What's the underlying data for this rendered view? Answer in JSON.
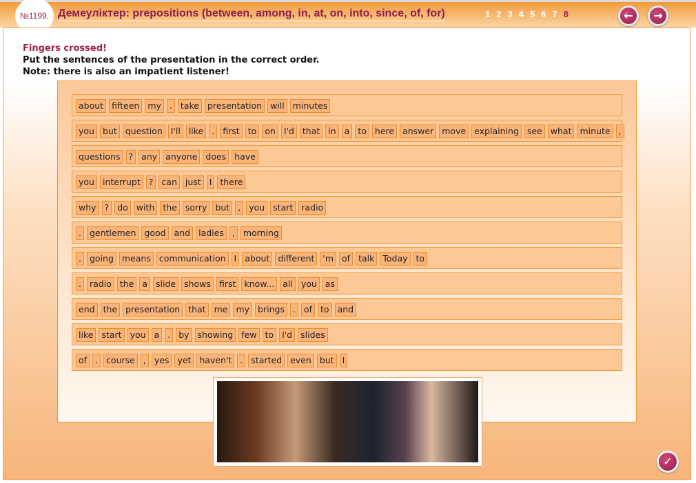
{
  "header": {
    "number": "№1199.",
    "title": "Демеуліктер: prepositions (between, among, in, at, on, into, since, of, for)",
    "pages": [
      "1",
      "2",
      "3",
      "4",
      "5",
      "6",
      "7",
      "8"
    ],
    "current_page": "8",
    "prev_icon": "arrow-left-icon",
    "next_icon": "arrow-right-icon"
  },
  "intro": {
    "heading": "Fingers crossed!",
    "line1": "Put the sentences of the presentation in the correct order.",
    "line2": "Note: there is also an impatient listener!"
  },
  "rows": [
    [
      "about",
      "fifteen",
      "my",
      ".",
      "take",
      "presentation",
      "will",
      "minutes"
    ],
    [
      "you",
      "but",
      "question",
      "I'll",
      "like",
      ".",
      "first",
      "to",
      "on",
      "I'd",
      "that",
      "in",
      "a",
      "to",
      "here",
      "answer",
      "move",
      "explaining",
      "see",
      "what",
      "minute",
      ","
    ],
    [
      "questions",
      "?",
      "any",
      "anyone",
      "does",
      "have"
    ],
    [
      "you",
      "interrupt",
      "?",
      "can",
      "just",
      "I",
      "there"
    ],
    [
      "why",
      "?",
      "do",
      "with",
      "the",
      "sorry",
      "but",
      ",",
      "you",
      "start",
      "radio"
    ],
    [
      ".",
      "gentlemen",
      "good",
      "and",
      "ladies",
      ",",
      "morning"
    ],
    [
      ".",
      "going",
      "means",
      "communication",
      "I",
      "about",
      "different",
      "'m",
      "of",
      "talk",
      "Today",
      "to"
    ],
    [
      ".",
      "radio",
      "the",
      "a",
      "slide",
      "shows",
      "first",
      "know...",
      "all",
      "you",
      "as"
    ],
    [
      "end",
      "the",
      "presentation",
      "that",
      "me",
      "my",
      "brings",
      ".",
      "of",
      "to",
      "and"
    ],
    [
      "like",
      "start",
      "you",
      "a",
      ".",
      "by",
      "showing",
      "few",
      "to",
      "I'd",
      "slides"
    ],
    [
      "of",
      ".",
      "course",
      ",",
      "yes",
      "yet",
      "haven't",
      ".",
      "started",
      "even",
      "but",
      "I"
    ]
  ],
  "check_icon": "checkmark-icon",
  "colors": {
    "accent": "#8e1e4e",
    "orange": "#f39a3a",
    "tile": "#f9b47a"
  }
}
